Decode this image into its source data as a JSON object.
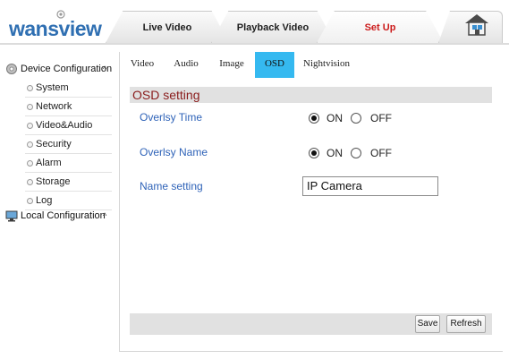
{
  "header": {
    "logo_text": "wansview",
    "tabs": [
      {
        "label": "Live Video"
      },
      {
        "label": "Playback Video"
      },
      {
        "label": "Set Up"
      }
    ],
    "home_icon": "home-icon",
    "active_tab_color": "#cc1c1c"
  },
  "sidebar": {
    "device_group": {
      "label": "Device Configuration",
      "caret": "^",
      "icon": "gear-icon"
    },
    "items": [
      {
        "label": "System"
      },
      {
        "label": "Network"
      },
      {
        "label": "Video&Audio"
      },
      {
        "label": "Security"
      },
      {
        "label": "Alarm"
      },
      {
        "label": "Storage"
      },
      {
        "label": "Log"
      }
    ],
    "local_group": {
      "label": "Local Configuration",
      "caret": "^",
      "icon": "computer-icon"
    }
  },
  "subtabs": [
    {
      "label": "Video"
    },
    {
      "label": "Audio"
    },
    {
      "label": "Image"
    },
    {
      "label": "OSD",
      "active": true
    },
    {
      "label": "Nightvision"
    }
  ],
  "osd": {
    "title": "OSD setting",
    "overlay_time": {
      "label": "Overlsy Time",
      "on_label": "ON",
      "off_label": "OFF",
      "selected": "ON"
    },
    "overlay_name": {
      "label": "Overlsy Name",
      "on_label": "ON",
      "off_label": "OFF",
      "selected": "ON"
    },
    "name_setting": {
      "label": "Name setting",
      "value": "IP Camera"
    }
  },
  "buttons": {
    "save": "Save",
    "refresh": "Refresh"
  },
  "colors": {
    "accent": "#35b9f0",
    "label_blue": "#2f63b8",
    "title_red": "#8a1c1c"
  }
}
